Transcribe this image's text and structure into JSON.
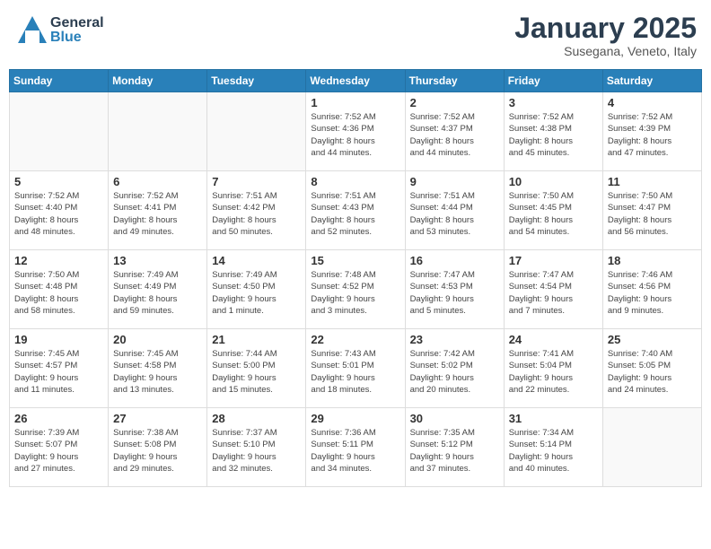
{
  "header": {
    "logo_general": "General",
    "logo_blue": "Blue",
    "month_title": "January 2025",
    "location": "Susegana, Veneto, Italy"
  },
  "weekdays": [
    "Sunday",
    "Monday",
    "Tuesday",
    "Wednesday",
    "Thursday",
    "Friday",
    "Saturday"
  ],
  "weeks": [
    [
      {
        "day": "",
        "info": ""
      },
      {
        "day": "",
        "info": ""
      },
      {
        "day": "",
        "info": ""
      },
      {
        "day": "1",
        "info": "Sunrise: 7:52 AM\nSunset: 4:36 PM\nDaylight: 8 hours\nand 44 minutes."
      },
      {
        "day": "2",
        "info": "Sunrise: 7:52 AM\nSunset: 4:37 PM\nDaylight: 8 hours\nand 44 minutes."
      },
      {
        "day": "3",
        "info": "Sunrise: 7:52 AM\nSunset: 4:38 PM\nDaylight: 8 hours\nand 45 minutes."
      },
      {
        "day": "4",
        "info": "Sunrise: 7:52 AM\nSunset: 4:39 PM\nDaylight: 8 hours\nand 47 minutes."
      }
    ],
    [
      {
        "day": "5",
        "info": "Sunrise: 7:52 AM\nSunset: 4:40 PM\nDaylight: 8 hours\nand 48 minutes."
      },
      {
        "day": "6",
        "info": "Sunrise: 7:52 AM\nSunset: 4:41 PM\nDaylight: 8 hours\nand 49 minutes."
      },
      {
        "day": "7",
        "info": "Sunrise: 7:51 AM\nSunset: 4:42 PM\nDaylight: 8 hours\nand 50 minutes."
      },
      {
        "day": "8",
        "info": "Sunrise: 7:51 AM\nSunset: 4:43 PM\nDaylight: 8 hours\nand 52 minutes."
      },
      {
        "day": "9",
        "info": "Sunrise: 7:51 AM\nSunset: 4:44 PM\nDaylight: 8 hours\nand 53 minutes."
      },
      {
        "day": "10",
        "info": "Sunrise: 7:50 AM\nSunset: 4:45 PM\nDaylight: 8 hours\nand 54 minutes."
      },
      {
        "day": "11",
        "info": "Sunrise: 7:50 AM\nSunset: 4:47 PM\nDaylight: 8 hours\nand 56 minutes."
      }
    ],
    [
      {
        "day": "12",
        "info": "Sunrise: 7:50 AM\nSunset: 4:48 PM\nDaylight: 8 hours\nand 58 minutes."
      },
      {
        "day": "13",
        "info": "Sunrise: 7:49 AM\nSunset: 4:49 PM\nDaylight: 8 hours\nand 59 minutes."
      },
      {
        "day": "14",
        "info": "Sunrise: 7:49 AM\nSunset: 4:50 PM\nDaylight: 9 hours\nand 1 minute."
      },
      {
        "day": "15",
        "info": "Sunrise: 7:48 AM\nSunset: 4:52 PM\nDaylight: 9 hours\nand 3 minutes."
      },
      {
        "day": "16",
        "info": "Sunrise: 7:47 AM\nSunset: 4:53 PM\nDaylight: 9 hours\nand 5 minutes."
      },
      {
        "day": "17",
        "info": "Sunrise: 7:47 AM\nSunset: 4:54 PM\nDaylight: 9 hours\nand 7 minutes."
      },
      {
        "day": "18",
        "info": "Sunrise: 7:46 AM\nSunset: 4:56 PM\nDaylight: 9 hours\nand 9 minutes."
      }
    ],
    [
      {
        "day": "19",
        "info": "Sunrise: 7:45 AM\nSunset: 4:57 PM\nDaylight: 9 hours\nand 11 minutes."
      },
      {
        "day": "20",
        "info": "Sunrise: 7:45 AM\nSunset: 4:58 PM\nDaylight: 9 hours\nand 13 minutes."
      },
      {
        "day": "21",
        "info": "Sunrise: 7:44 AM\nSunset: 5:00 PM\nDaylight: 9 hours\nand 15 minutes."
      },
      {
        "day": "22",
        "info": "Sunrise: 7:43 AM\nSunset: 5:01 PM\nDaylight: 9 hours\nand 18 minutes."
      },
      {
        "day": "23",
        "info": "Sunrise: 7:42 AM\nSunset: 5:02 PM\nDaylight: 9 hours\nand 20 minutes."
      },
      {
        "day": "24",
        "info": "Sunrise: 7:41 AM\nSunset: 5:04 PM\nDaylight: 9 hours\nand 22 minutes."
      },
      {
        "day": "25",
        "info": "Sunrise: 7:40 AM\nSunset: 5:05 PM\nDaylight: 9 hours\nand 24 minutes."
      }
    ],
    [
      {
        "day": "26",
        "info": "Sunrise: 7:39 AM\nSunset: 5:07 PM\nDaylight: 9 hours\nand 27 minutes."
      },
      {
        "day": "27",
        "info": "Sunrise: 7:38 AM\nSunset: 5:08 PM\nDaylight: 9 hours\nand 29 minutes."
      },
      {
        "day": "28",
        "info": "Sunrise: 7:37 AM\nSunset: 5:10 PM\nDaylight: 9 hours\nand 32 minutes."
      },
      {
        "day": "29",
        "info": "Sunrise: 7:36 AM\nSunset: 5:11 PM\nDaylight: 9 hours\nand 34 minutes."
      },
      {
        "day": "30",
        "info": "Sunrise: 7:35 AM\nSunset: 5:12 PM\nDaylight: 9 hours\nand 37 minutes."
      },
      {
        "day": "31",
        "info": "Sunrise: 7:34 AM\nSunset: 5:14 PM\nDaylight: 9 hours\nand 40 minutes."
      },
      {
        "day": "",
        "info": ""
      }
    ]
  ]
}
